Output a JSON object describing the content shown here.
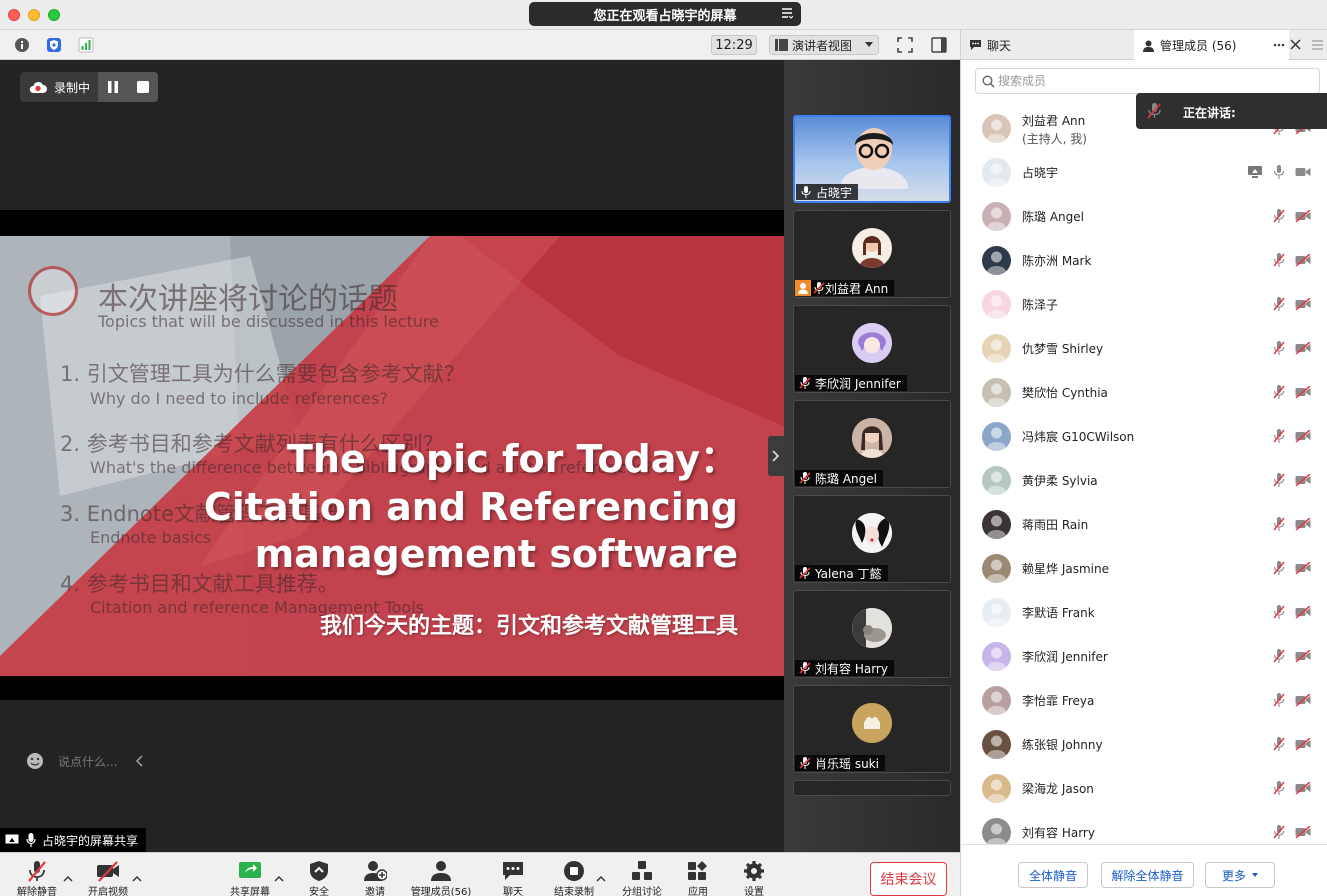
{
  "window": {
    "viewing_banner": "您正在观看占晓宇的屏幕"
  },
  "toolbar": {
    "time": "12:29",
    "view_mode": "演讲者视图"
  },
  "recording": {
    "label": "录制中"
  },
  "slide": {
    "title_lines": [
      "The Topic for Today：",
      "Citation and Referencing",
      "management software"
    ],
    "cn_title": "我们今天的主题：引文和参考文献管理工具",
    "faded_heading": "本次讲座将讨论的话题",
    "faded_heading_en": "Topics that will be discussed in this lecture",
    "faded_items": [
      "1.  引文管理工具为什么需要包含参考文献？",
      "Why do I need to include references?",
      "2.  参考书目和参考文献列表有什么区别？",
      "What's the difference between a bibliography and a list of references?",
      "3.  Endnote文献管理工具基础",
      "Endnote basics",
      "4.  参考书目和文献工具推荐。",
      "Citation and reference Management Tools"
    ]
  },
  "chat_input": {
    "placeholder": "说点什么..."
  },
  "screen_share_label": "占晓宇的屏幕共享",
  "video_tiles": [
    {
      "name": "占晓宇"
    },
    {
      "name": "刘益君 Ann"
    },
    {
      "name": "李欣润 Jennifer"
    },
    {
      "name": "陈璐 Angel"
    },
    {
      "name": "Yalena 丁懿"
    },
    {
      "name": "刘有容 Harry"
    },
    {
      "name": "肖乐瑶 suki"
    }
  ],
  "panel": {
    "chat_tab": "聊天",
    "members_tab": "管理成员 (56)",
    "search_placeholder": "搜索成员",
    "speaking_label": "正在讲话:",
    "mute_all": "全体静音",
    "unmute_all": "解除全体静音",
    "more": "更多"
  },
  "members": [
    {
      "name": "刘益君 Ann",
      "sub": "(主持人, 我)"
    },
    {
      "name": "占晓宇",
      "sub": ""
    },
    {
      "name": "陈璐 Angel",
      "sub": ""
    },
    {
      "name": "陈亦洲 Mark",
      "sub": ""
    },
    {
      "name": "陈泽子",
      "sub": ""
    },
    {
      "name": "仇梦雪 Shirley",
      "sub": ""
    },
    {
      "name": "樊欣怡 Cynthia",
      "sub": ""
    },
    {
      "name": "冯炜宸 G10CWilson",
      "sub": ""
    },
    {
      "name": "黄伊柔 Sylvia",
      "sub": ""
    },
    {
      "name": "蒋雨田 Rain",
      "sub": ""
    },
    {
      "name": "赖星烨 Jasmine",
      "sub": ""
    },
    {
      "name": "李默语 Frank",
      "sub": ""
    },
    {
      "name": "李欣润 Jennifer",
      "sub": ""
    },
    {
      "name": "李怡霏 Freya",
      "sub": ""
    },
    {
      "name": "练张银 Johnny",
      "sub": ""
    },
    {
      "name": "梁海龙 Jason",
      "sub": ""
    },
    {
      "name": "刘有容 Harry",
      "sub": ""
    }
  ],
  "bottom_bar": {
    "unmute": "解除静音",
    "start_video": "开启视频",
    "share_screen": "共享屏幕",
    "security": "安全",
    "invite": "邀请",
    "manage_members": "管理成员(56)",
    "chat": "聊天",
    "end_recording": "结束录制",
    "breakout": "分组讨论",
    "apps": "应用",
    "settings": "设置",
    "end_meeting": "结束会议"
  },
  "colors": {
    "accent_blue": "#3d7ff0",
    "end_red": "#e0383e",
    "muted_red": "#e0383e"
  }
}
